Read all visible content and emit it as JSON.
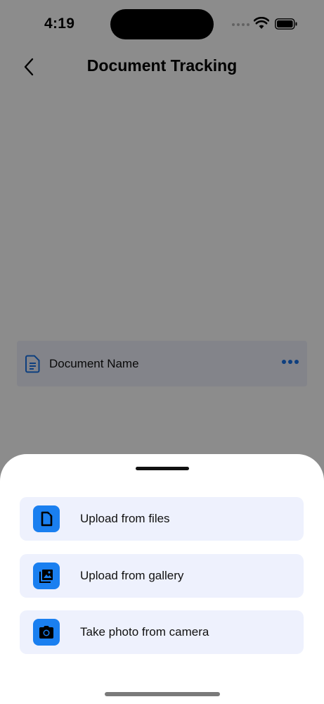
{
  "status_bar": {
    "time": "4:19"
  },
  "nav": {
    "title": "Document Tracking",
    "back_icon": "chevron-left-icon"
  },
  "document": {
    "name": "Document Name",
    "icon": "document-icon",
    "more_icon": "more-horizontal-icon",
    "accent": "#1a73e8"
  },
  "sheet": {
    "options": [
      {
        "label": "Upload from files",
        "icon": "file-icon"
      },
      {
        "label": "Upload from gallery",
        "icon": "gallery-icon"
      },
      {
        "label": "Take photo from camera",
        "icon": "camera-icon"
      }
    ],
    "badge_color": "#1a7ff0",
    "option_background": "#eef1fd"
  }
}
